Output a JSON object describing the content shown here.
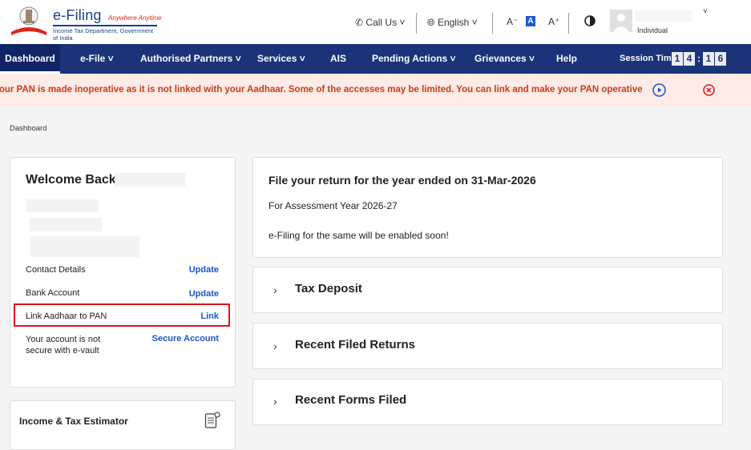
{
  "header": {
    "brand_name": "e-Filing",
    "brand_tagline": "Anywhere Anytime",
    "brand_sub": "Income Tax Department, Government of India",
    "call_us": "Call Us",
    "language": "English",
    "font_decrease": "A⁻",
    "font_normal": "A",
    "font_increase": "A⁺",
    "user_role": "Individual"
  },
  "nav": {
    "items": [
      {
        "label": "Dashboard"
      },
      {
        "label": "e-File ˅"
      },
      {
        "label": "Authorised Partners ˅"
      },
      {
        "label": "Services ˅"
      },
      {
        "label": "AIS"
      },
      {
        "label": "Pending Actions ˅"
      },
      {
        "label": "Grievances ˅"
      },
      {
        "label": "Help"
      }
    ],
    "session_label": "Session Time",
    "session_digits": [
      "1",
      "4",
      ":",
      "1",
      "6"
    ]
  },
  "alert": {
    "text": "Your PAN is made inoperative as it is not linked with your Aadhaar. Some of the accesses may be limited. You can link and make your PAN operative after paying the fee."
  },
  "breadcrumb": "Dashboard",
  "profile_card": {
    "welcome": "Welcome Back,",
    "rows": [
      {
        "label": "Contact Details",
        "action": "Update"
      },
      {
        "label": "Bank Account",
        "action": "Update"
      },
      {
        "label": "Link Aadhaar to PAN",
        "action": "Link"
      },
      {
        "label": "Your account is not",
        "label2": "secure with e-vault",
        "action": "Secure Account"
      }
    ]
  },
  "estimator": {
    "label": "Income & Tax Estimator"
  },
  "return_card": {
    "title": "File your return for the year ended on 31-Mar-2026",
    "assessment_year": "For Assessment Year 2026-27",
    "note": "e-Filing for the same will be enabled soon!"
  },
  "accordions": [
    {
      "label": "Tax Deposit"
    },
    {
      "label": "Recent Filed Returns"
    },
    {
      "label": "Recent Forms Filed"
    }
  ],
  "colors": {
    "nav_bg": "#1a3379",
    "alert_bg": "#fcebe6",
    "alert_text": "#c93b1b",
    "link": "#1a55c9",
    "highlight": "#d9141c"
  }
}
